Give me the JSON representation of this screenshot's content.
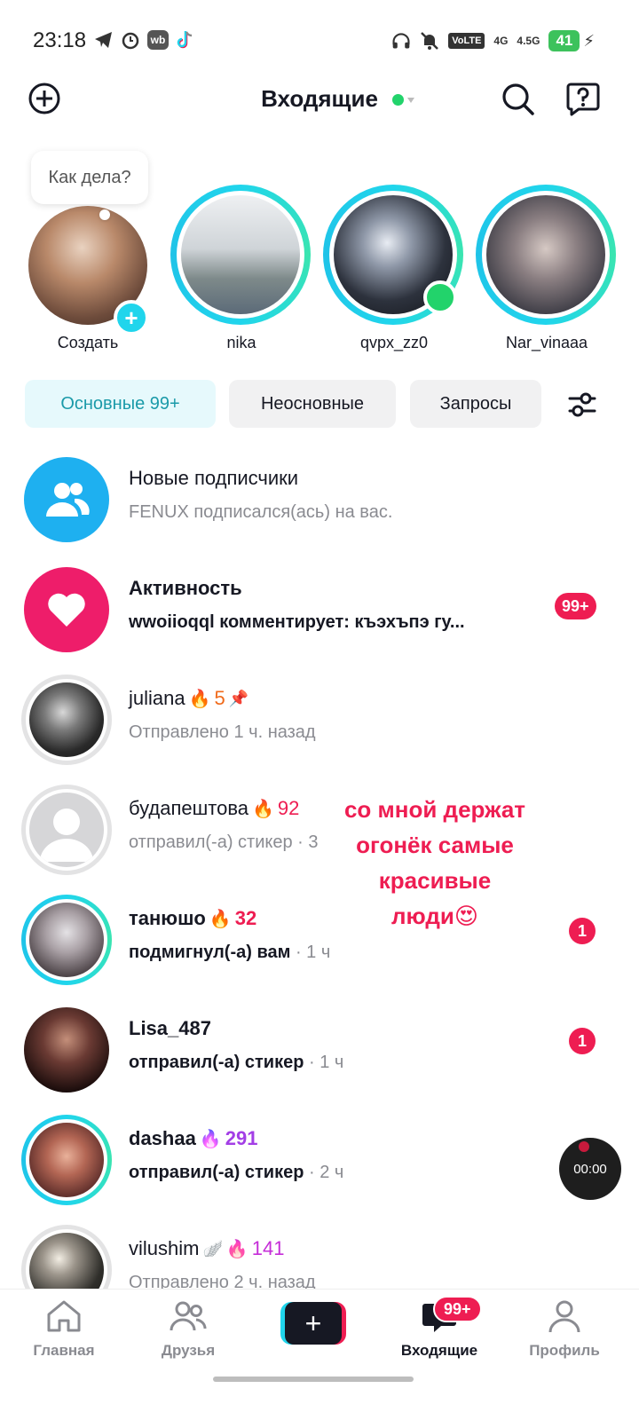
{
  "status_bar": {
    "time": "23:18",
    "left_icons": [
      "telegram-icon",
      "alarm-icon",
      "wb-icon",
      "tiktok-icon"
    ],
    "wb_label": "wb",
    "right_icons": [
      "headphones-icon",
      "bell-off-icon",
      "volte-icon",
      "signal-4g-icon",
      "signal-4-5g-icon",
      "battery-icon",
      "charging-icon"
    ],
    "volte_label": "VoLTE",
    "net1": "4G",
    "net2": "4.5G",
    "battery_level": "41"
  },
  "header": {
    "title": "Входящие",
    "online_color": "#22d36b"
  },
  "stories": {
    "bubble_text": "Как дела?",
    "items": [
      {
        "name": "Создать",
        "type": "create"
      },
      {
        "name": "nika",
        "type": "story"
      },
      {
        "name": "qvpx_zz0",
        "type": "story",
        "online": true
      },
      {
        "name": "Nar_vinaaa",
        "type": "story"
      }
    ]
  },
  "tabs": {
    "main": "Основные 99+",
    "secondary": "Неосновные",
    "requests": "Запросы"
  },
  "list": [
    {
      "title": "Новые подписчики",
      "subtitle": "FENUX подписался(ась) на вас."
    },
    {
      "title": "Активность",
      "subtitle": "wwoiioqql комментирует: къэхъпэ гу...",
      "badge": "99+"
    },
    {
      "title": "juliana",
      "streak": "5",
      "subtitle": "Отправлено 1 ч. назад",
      "pinned": true
    },
    {
      "title": "будапештова",
      "streak": "92",
      "subtitle": "отправил(-а) стикер",
      "time": "· 3"
    },
    {
      "title": "танюшо",
      "streak": "32",
      "subtitle": "подмигнул(-а) вам",
      "time": "· 1 ч",
      "badge": "1"
    },
    {
      "title": "Lisa_487",
      "subtitle": "отправил(-а) стикер",
      "time": "· 1 ч",
      "badge": "1"
    },
    {
      "title": "dashaa",
      "streak": "291",
      "subtitle": "отправил(-а) стикер",
      "time": "· 2 ч"
    },
    {
      "title": "vilushim",
      "streak": "141",
      "subtitle": "Отправлено 2 ч. назад",
      "online": true
    }
  ],
  "overlay_caption": [
    "со мной держат",
    "огонёк самые",
    "красивые",
    "люди😍"
  ],
  "timer": "00:00",
  "bottom_nav": {
    "home": "Главная",
    "friends": "Друзья",
    "inbox": "Входящие",
    "inbox_badge": "99+",
    "profile": "Профиль",
    "active": "inbox"
  },
  "colors": {
    "accent_teal": "#20d5ec",
    "accent_red": "#ee1d52",
    "followers_blue": "#1eb0f0",
    "activity_pink": "#ee1d6a"
  }
}
